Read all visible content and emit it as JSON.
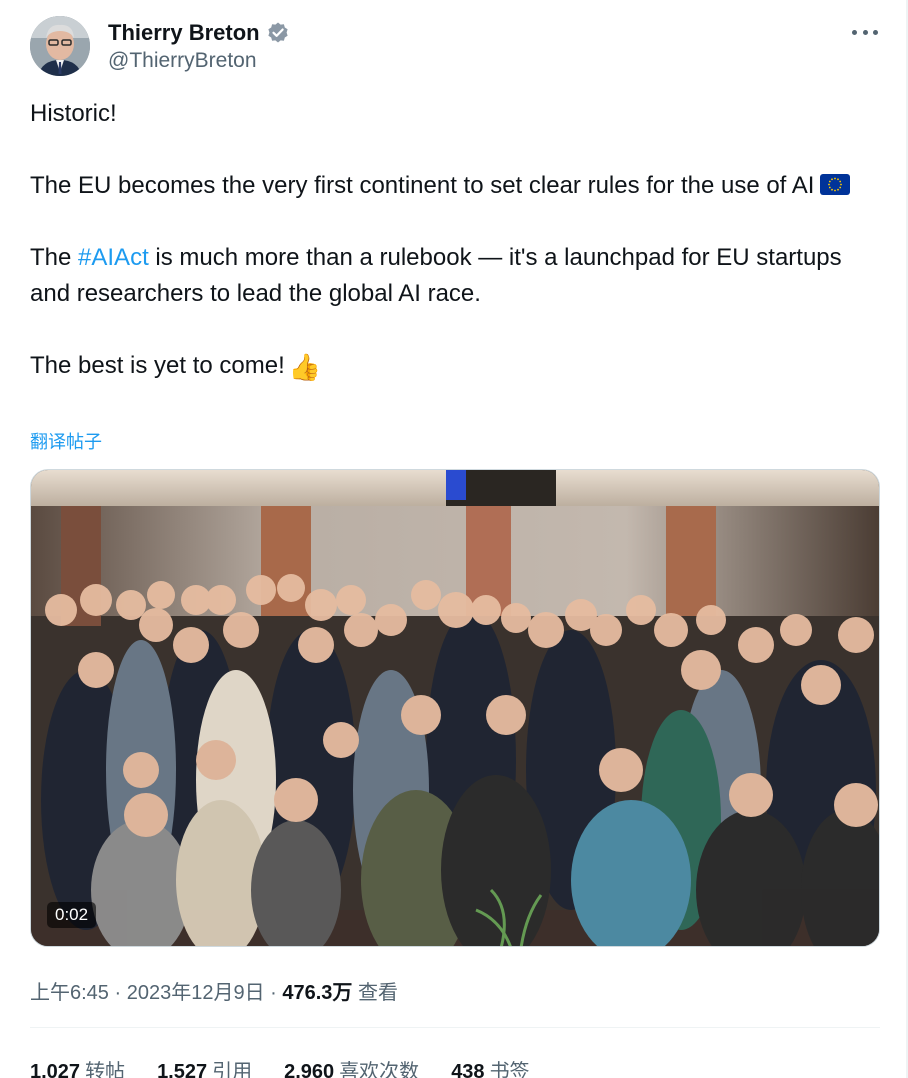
{
  "author": {
    "name": "Thierry Breton",
    "handle": "@ThierryBreton",
    "verified_icon": "verified-badge-icon",
    "verified_color": "#8b98a5"
  },
  "more_icon": "more-horizontal-icon",
  "tweet": {
    "line1": "Historic!",
    "line2": "The EU becomes the very first continent to set clear rules for the use of AI",
    "line2_emoji": "eu-flag-emoji",
    "line3_before": "The ",
    "line3_hashtag": "#AIAct",
    "line3_after": " is much more than a rulebook — it's a launchpad for EU startups and researchers to lead the global AI race.",
    "line4": "The best is yet to come!",
    "line4_emoji": "👍"
  },
  "translate_label": "翻译帖子",
  "media": {
    "type": "video",
    "duration": "0:02"
  },
  "meta": {
    "time": "上午6:45",
    "separator": " · ",
    "date": "2023年12月9日",
    "views_count": "476.3万",
    "views_label": "查看"
  },
  "stats": [
    {
      "count": "1,027",
      "label": "转帖"
    },
    {
      "count": "1,527",
      "label": "引用"
    },
    {
      "count": "2,960",
      "label": "喜欢次数"
    },
    {
      "count": "438",
      "label": "书签"
    }
  ],
  "colors": {
    "text": "#0f1419",
    "secondary": "#536471",
    "link": "#1d9bf0",
    "border": "#eff3f4"
  }
}
